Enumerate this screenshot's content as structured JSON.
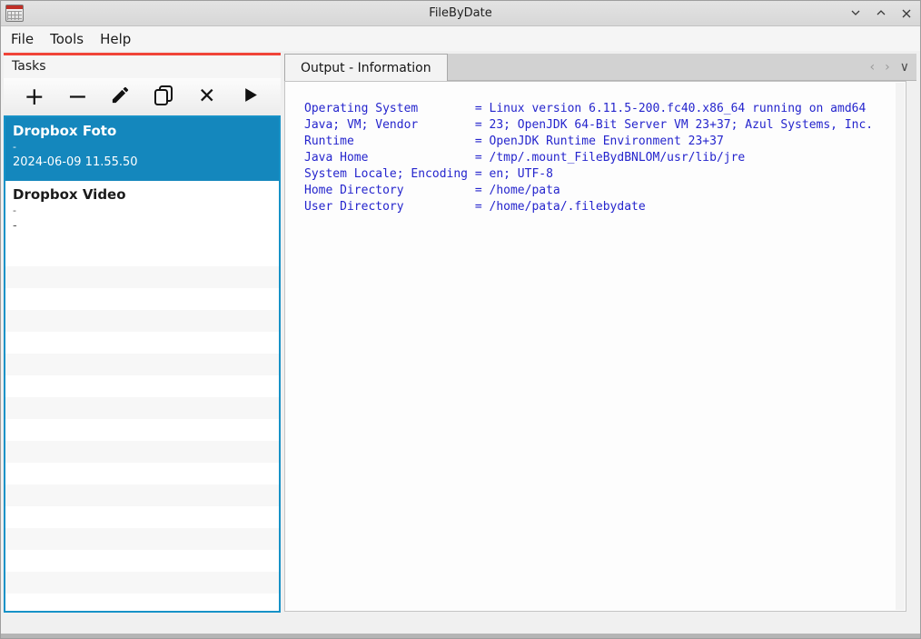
{
  "colors": {
    "accent_red": "#f04438",
    "selection_blue": "#1487bd",
    "output_text_blue": "#2525cd"
  },
  "window": {
    "title": "FileByDate",
    "controls": [
      {
        "icon": "chevron-down-minimize-icon"
      },
      {
        "icon": "chevron-up-maximize-icon"
      },
      {
        "icon": "close-icon"
      }
    ]
  },
  "menu": {
    "items": [
      {
        "label": "File"
      },
      {
        "label": "Tools"
      },
      {
        "label": "Help"
      }
    ]
  },
  "tasks_panel": {
    "header": "Tasks",
    "toolbar": [
      {
        "icon": "plus-icon",
        "glyph": "+"
      },
      {
        "icon": "minus-icon",
        "glyph": "−"
      },
      {
        "icon": "pencil-icon"
      },
      {
        "icon": "copy-icon"
      },
      {
        "icon": "x-icon",
        "glyph": "✕"
      },
      {
        "icon": "play-icon"
      }
    ],
    "items": [
      {
        "title": "Dropbox Foto",
        "line2": "-",
        "line3": "2024-06-09 11.55.50",
        "selected": true
      },
      {
        "title": "Dropbox Video",
        "line2": "-",
        "line3": "-",
        "selected": false
      }
    ]
  },
  "tabs": {
    "active_label": "Output - Information",
    "controls": {
      "prev": "‹",
      "next": "›",
      "list": "∨"
    }
  },
  "output": {
    "lines": [
      {
        "key": "Operating System",
        "value": "Linux version 6.11.5-200.fc40.x86_64 running on amd64"
      },
      {
        "key": "Java; VM; Vendor",
        "value": "23; OpenJDK 64-Bit Server VM 23+37; Azul Systems, Inc."
      },
      {
        "key": "Runtime",
        "value": "OpenJDK Runtime Environment 23+37"
      },
      {
        "key": "Java Home",
        "value": "/tmp/.mount_FileBydBNLOM/usr/lib/jre"
      },
      {
        "key": "System Locale; Encoding",
        "value": "en; UTF-8"
      },
      {
        "key": "Home Directory",
        "value": "/home/pata"
      },
      {
        "key": "User Directory",
        "value": "/home/pata/.filebydate"
      }
    ]
  }
}
